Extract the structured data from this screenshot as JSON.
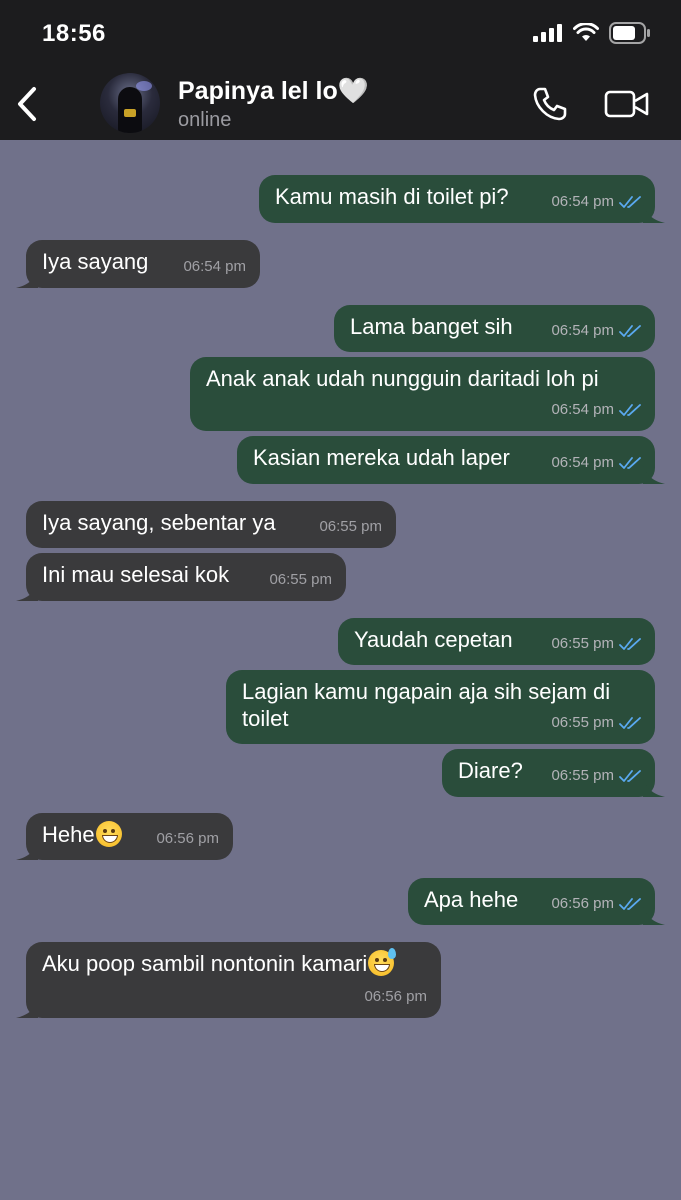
{
  "status_bar": {
    "time": "18:56"
  },
  "header": {
    "contact_name": "Papinya lel lo🤍",
    "contact_status": "online"
  },
  "colors": {
    "chat_background": "#70718a",
    "outgoing_bubble": "#2a4d3b",
    "incoming_bubble": "#3a3a3c",
    "read_ticks": "#5aa9f0",
    "header_bg": "#1c1c1e"
  },
  "messages": [
    {
      "direction": "out",
      "text": "Kamu masih di toilet pi?",
      "time": "06:54 pm",
      "status": "read"
    },
    {
      "direction": "in",
      "text": "Iya sayang",
      "time": "06:54 pm"
    },
    {
      "direction": "out",
      "text": "Lama banget sih",
      "time": "06:54 pm",
      "status": "read"
    },
    {
      "direction": "out",
      "text": "Anak anak udah nungguin daritadi loh pi",
      "time": "06:54 pm",
      "status": "read"
    },
    {
      "direction": "out",
      "text": "Kasian mereka udah laper",
      "time": "06:54 pm",
      "status": "read"
    },
    {
      "direction": "in",
      "text": "Iya sayang, sebentar ya",
      "time": "06:55 pm"
    },
    {
      "direction": "in",
      "text": "Ini mau selesai kok",
      "time": "06:55 pm"
    },
    {
      "direction": "out",
      "text": "Yaudah cepetan",
      "time": "06:55 pm",
      "status": "read"
    },
    {
      "direction": "out",
      "text": "Lagian kamu ngapain aja sih sejam di toilet",
      "time": "06:55 pm",
      "status": "read"
    },
    {
      "direction": "out",
      "text": "Diare?",
      "time": "06:55 pm",
      "status": "read"
    },
    {
      "direction": "in",
      "text": "Hehe",
      "emoji": "grinning-face-with-smiling-eyes",
      "time": "06:56 pm"
    },
    {
      "direction": "out",
      "text": "Apa hehe",
      "time": "06:56 pm",
      "status": "read"
    },
    {
      "direction": "in",
      "text": "Aku poop sambil nontonin kamari",
      "emoji": "grinning-face-with-sweat",
      "time": "06:56 pm"
    }
  ]
}
